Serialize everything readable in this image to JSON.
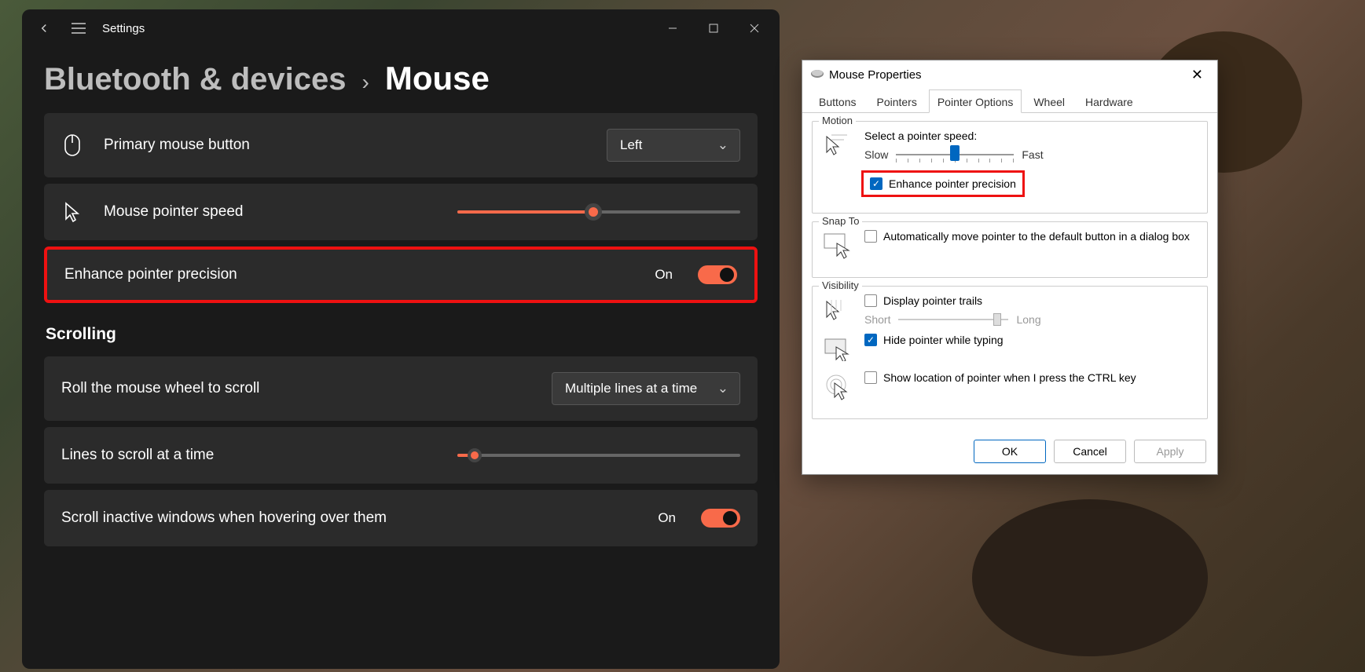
{
  "settings": {
    "app_title": "Settings",
    "breadcrumb_parent": "Bluetooth & devices",
    "breadcrumb_sep": "›",
    "breadcrumb_current": "Mouse",
    "primary_button_label": "Primary mouse button",
    "primary_button_value": "Left",
    "pointer_speed_label": "Mouse pointer speed",
    "pointer_speed_percent": 48,
    "enhance_precision_label": "Enhance pointer precision",
    "enhance_precision_state": "On",
    "scrolling_heading": "Scrolling",
    "roll_wheel_label": "Roll the mouse wheel to scroll",
    "roll_wheel_value": "Multiple lines at a time",
    "lines_scroll_label": "Lines to scroll at a time",
    "lines_scroll_percent": 6,
    "scroll_inactive_label": "Scroll inactive windows when hovering over them",
    "scroll_inactive_state": "On"
  },
  "dialog": {
    "title": "Mouse Properties",
    "tabs": [
      "Buttons",
      "Pointers",
      "Pointer Options",
      "Wheel",
      "Hardware"
    ],
    "active_tab": "Pointer Options",
    "motion": {
      "group": "Motion",
      "label": "Select a pointer speed:",
      "slow": "Slow",
      "fast": "Fast",
      "speed_percent": 50,
      "enhance_label": "Enhance pointer precision",
      "enhance_checked": true
    },
    "snapto": {
      "group": "Snap To",
      "label": "Automatically move pointer to the default button in a dialog box",
      "checked": false
    },
    "visibility": {
      "group": "Visibility",
      "trails_label": "Display pointer trails",
      "trails_checked": false,
      "short": "Short",
      "long": "Long",
      "trails_percent": 90,
      "hide_label": "Hide pointer while typing",
      "hide_checked": true,
      "ctrl_label": "Show location of pointer when I press the CTRL key",
      "ctrl_checked": false
    },
    "buttons": {
      "ok": "OK",
      "cancel": "Cancel",
      "apply": "Apply"
    }
  }
}
